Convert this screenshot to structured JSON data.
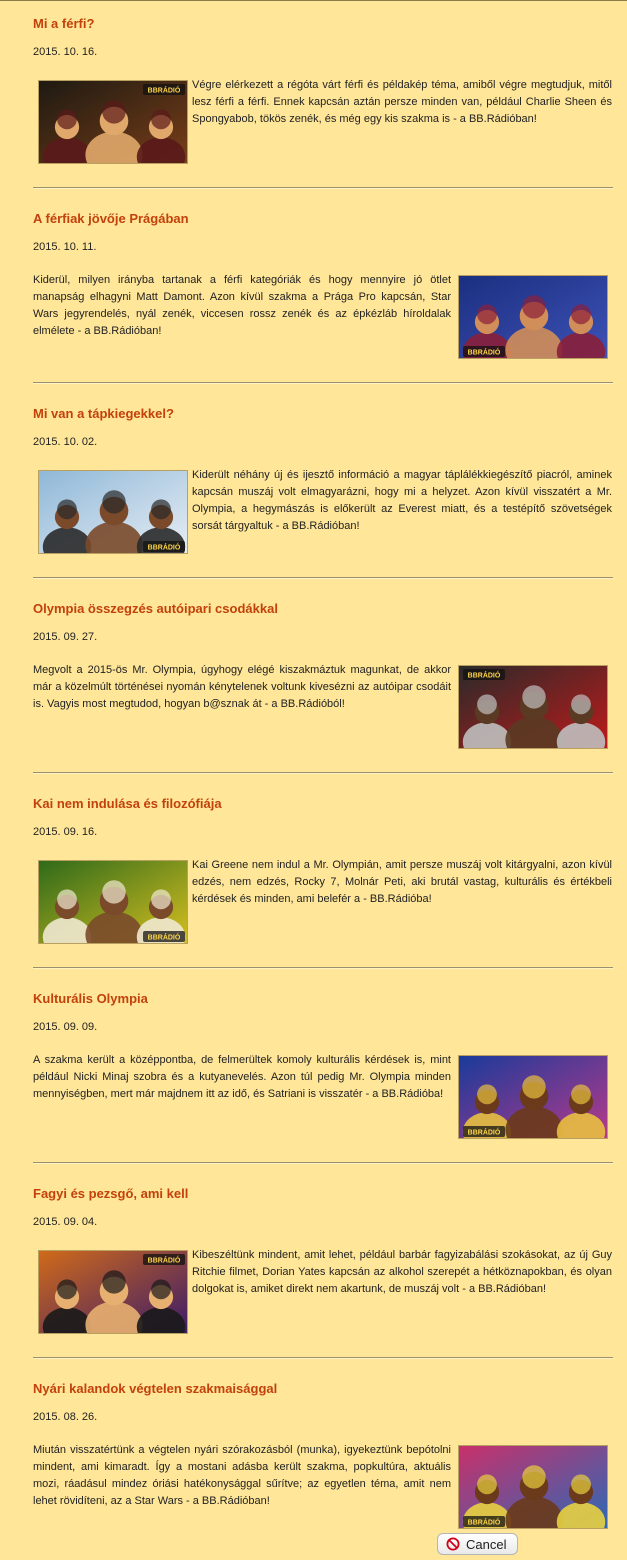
{
  "posts": [
    {
      "title": "Mi a férfi?",
      "date": "2015. 10. 16.",
      "text": "Végre elérkezett a régóta várt férfi és példakép téma, amiből végre megtudjuk, mitől lesz férfi a férfi. Ennek kapcsán aztán persze minden van, például Charlie Sheen és Spongyabob, tökös zenék, és még egy kis szakma is - a BB.Rádióban!",
      "image_side": "left",
      "badge": "BBRÁDIÓ",
      "palette": [
        "#1e1a12",
        "#7a3e18",
        "#e0a86a",
        "#5a1a1a"
      ]
    },
    {
      "title": "A férfiak jövője Prágában",
      "date": "2015. 10. 11.",
      "text": "Kiderül, milyen irányba tartanak a férfi kategóriák és hogy mennyire jó ötlet manapság elhagyni Matt Damont. Azon kívül szakma a Prága Pro kapcsán, Star Wars jegyrendelés, nyál zenék, viccesen rossz zenék és az épkézláb híroldalak elmélete - a BB.Rádióban!",
      "image_side": "right",
      "badge": "BBRÁDIÓ",
      "palette": [
        "#1b2f80",
        "#3e52b8",
        "#d28e58",
        "#8a1f3a"
      ]
    },
    {
      "title": "Mi van a tápkiegekkel?",
      "date": "2015. 10. 02.",
      "text": "Kiderült néhány új és ijesztő információ a magyar táplálékkiegészítő piacról, aminek kapcsán muszáj volt elmagyarázni, hogy mi a helyzet. Azon kívül visszatért a Mr. Olympia, a hegymászás is előkerült az Everest miatt, és a testépítő szövetségek sorsát tárgyaltuk - a BB.Rádióban!",
      "image_side": "left",
      "badge": "BBRÁDIÓ",
      "palette": [
        "#8fb8d8",
        "#e8eef4",
        "#7a4a2a",
        "#2a2a2a"
      ]
    },
    {
      "title": "Olympia összegzés autóipari csodákkal",
      "date": "2015. 09. 27.",
      "text": "Megvolt a 2015-ös Mr. Olympia, úgyhogy elégé kiszakmáztuk magunkat, de akkor már a közelmúlt történései nyomán kénytelenek voltunk kivesézni az autóipar csodáit is. Vagyis most megtudod, hogyan b@sznak át - a BB.Rádióból!",
      "image_side": "right",
      "badge": "BBRÁDIÓ",
      "palette": [
        "#2a2a2a",
        "#c01a1a",
        "#5a3a22",
        "#bfbfbf"
      ]
    },
    {
      "title": "Kai nem indulása és filozófiája",
      "date": "2015. 09. 16.",
      "text": "Kai Greene nem indul a Mr. Olympián, amit persze muszáj volt kitárgyalni, azon kívül edzés, nem edzés, Rocky 7, Molnár Peti, aki brutál vastag, kulturális és értékbeli kérdések és minden, ami belefér a - BB.Rádióba!",
      "image_side": "left",
      "badge": "BBRÁDIÓ",
      "palette": [
        "#2f6a1a",
        "#d8c020",
        "#7a4a2a",
        "#f0e8d0"
      ]
    },
    {
      "title": "Kulturális Olympia",
      "date": "2015. 09. 09.",
      "text": "A szakma került a középpontba, de felmerültek komoly kulturális kérdések is, mint például Nicki Minaj szobra és a kutyanevelés. Azon túl pedig Mr. Olympia minden mennyiségben, mert már majdnem itt az idő, és Satriani is visszatér - a BB.Rádióba!",
      "image_side": "right",
      "badge": "BBRÁDIÓ",
      "palette": [
        "#1a3a9a",
        "#b83a8a",
        "#6a3a1a",
        "#e8c040"
      ]
    },
    {
      "title": "Fagyi és pezsgő, ami kell",
      "date": "2015. 09. 04.",
      "text": "Kibeszéltünk mindent, amit lehet, például barbár fagyizabálási szokásokat, az új Guy Ritchie filmet, Dorian Yates kapcsán az alkohol szerepét a hétköznapokban, és olyan dolgokat is, amiket direkt nem akartunk, de muszáj volt - a BB.Rádióban!",
      "image_side": "left",
      "badge": "BBRÁDIÓ",
      "palette": [
        "#d06a1a",
        "#3a1a6a",
        "#e8b070",
        "#1a1a1a"
      ]
    },
    {
      "title": "Nyári kalandok végtelen szakmaisággal",
      "date": "2015. 08. 26.",
      "text": "Miután visszatértünk a végtelen nyári szórakozásból (munka), igyekeztünk bepótolni mindent, ami kimaradt. Így a mostani adásba került szakma, popkultúra, aktuális mozi, ráadásul mindez óriási hatékonysággal sűrítve; az egyetlen téma, amit nem lehet rövidíteni, az a Star Wars - a BB.Rádióban!",
      "image_side": "right",
      "badge": "BBRÁDIÓ",
      "palette": [
        "#c8306a",
        "#2a6ab8",
        "#6a3a1a",
        "#e8d040"
      ]
    }
  ],
  "cancel_button": {
    "label": "Cancel",
    "icon": "no-entry-icon",
    "icon_color": "#d0021b"
  }
}
